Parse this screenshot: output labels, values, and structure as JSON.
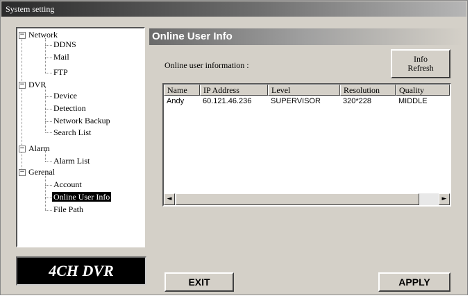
{
  "window": {
    "title": "System setting"
  },
  "tree": {
    "network": {
      "label": "Network",
      "toggle": "−",
      "children": [
        "DDNS",
        "Mail",
        "FTP"
      ]
    },
    "dvr": {
      "label": "DVR",
      "toggle": "−",
      "children": [
        "Device",
        "Detection",
        "Network Backup",
        "Search List"
      ]
    },
    "alarm": {
      "label": "Alarm",
      "toggle": "−",
      "children": [
        "Alarm List"
      ]
    },
    "general": {
      "label": "Gerenal",
      "toggle": "−",
      "children": [
        "Account",
        "Online User Info",
        "File Path"
      ]
    }
  },
  "logo": "4CH DVR",
  "panel": {
    "title": "Online User Info",
    "label": "Online user information :",
    "refresh_line1": "Info",
    "refresh_line2": "Refresh"
  },
  "table": {
    "columns": [
      "Name",
      "IP Address",
      "Level",
      "Resolution",
      "Quality"
    ],
    "rows": [
      [
        "Andy",
        "60.121.46.236",
        "SUPERVISOR",
        "320*228",
        "MIDDLE"
      ]
    ]
  },
  "scroll": {
    "left": "◄",
    "right": "►"
  },
  "buttons": {
    "exit": "EXIT",
    "apply": "APPLY"
  }
}
